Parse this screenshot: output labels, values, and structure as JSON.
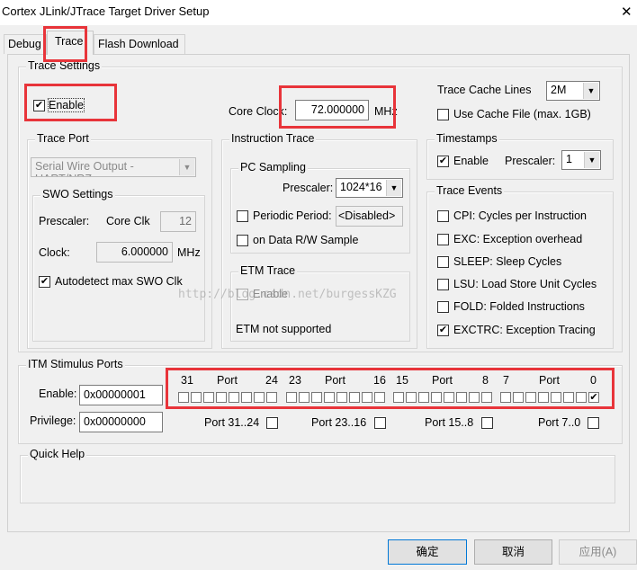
{
  "window": {
    "title": "Cortex JLink/JTrace Target Driver Setup",
    "close": "✕"
  },
  "tabs": [
    {
      "label": "Debug"
    },
    {
      "label": "Trace"
    },
    {
      "label": "Flash Download"
    }
  ],
  "trace_settings": {
    "title": "Trace Settings",
    "enable_label": "Enable",
    "enable_checked": true,
    "core_clock_label": "Core Clock:",
    "core_clock_value": "72.000000",
    "core_clock_unit": "MHz",
    "cache_lines_label": "Trace Cache Lines",
    "cache_lines_value": "2M",
    "use_cache_label": "Use Cache File (max. 1GB)",
    "use_cache_checked": false
  },
  "trace_port": {
    "title": "Trace Port",
    "value": "Serial Wire Output - UART/NRZ",
    "swo": {
      "title": "SWO Settings",
      "prescaler_label": "Prescaler:",
      "core_clk_label": "Core Clk",
      "prescaler_value": "12",
      "clock_label": "Clock:",
      "clock_value": "6.000000",
      "clock_unit": "MHz",
      "autodetect_label": "Autodetect max SWO Clk",
      "autodetect_checked": true
    }
  },
  "instruction_trace": {
    "title": "Instruction Trace",
    "pc_sampling": {
      "title": "PC Sampling",
      "prescaler_label": "Prescaler:",
      "prescaler_value": "1024*16",
      "periodic_label": "Periodic",
      "period_label": "Period:",
      "period_value": "<Disabled>",
      "data_rw_label": "on Data R/W Sample"
    },
    "etm": {
      "title": "ETM Trace",
      "enable_label": "Enable",
      "status": "ETM not supported"
    }
  },
  "timestamps": {
    "title": "Timestamps",
    "enable_label": "Enable",
    "enable_checked": true,
    "prescaler_label": "Prescaler:",
    "prescaler_value": "1"
  },
  "trace_events": {
    "title": "Trace Events",
    "items": [
      {
        "label": "CPI: Cycles per Instruction",
        "checked": false
      },
      {
        "label": "EXC: Exception overhead",
        "checked": false
      },
      {
        "label": "SLEEP: Sleep Cycles",
        "checked": false
      },
      {
        "label": "LSU: Load Store Unit Cycles",
        "checked": false
      },
      {
        "label": "FOLD: Folded Instructions",
        "checked": false
      },
      {
        "label": "EXCTRC: Exception Tracing",
        "checked": true
      }
    ]
  },
  "itm": {
    "title": "ITM Stimulus Ports",
    "enable_label": "Enable:",
    "enable_value": "0x00000001",
    "privilege_label": "Privilege:",
    "privilege_value": "0x00000000",
    "headers": [
      {
        "hi": "31",
        "port": "Port",
        "lo": "24"
      },
      {
        "hi": "23",
        "port": "Port",
        "lo": "16"
      },
      {
        "hi": "15",
        "port": "Port",
        "lo": "8"
      },
      {
        "hi": "7",
        "port": "Port",
        "lo": "0"
      }
    ],
    "enabled_bits": [
      0
    ],
    "privilege_groups": [
      {
        "label": "Port 31..24",
        "checked": false
      },
      {
        "label": "Port 23..16",
        "checked": false
      },
      {
        "label": "Port 15..8",
        "checked": false
      },
      {
        "label": "Port 7..0",
        "checked": false
      }
    ]
  },
  "quick_help": {
    "title": "Quick Help"
  },
  "buttons": {
    "ok": "确定",
    "cancel": "取消",
    "apply": "应用(A)"
  },
  "watermark": "http://blog.csdn.net/burgessKZG"
}
